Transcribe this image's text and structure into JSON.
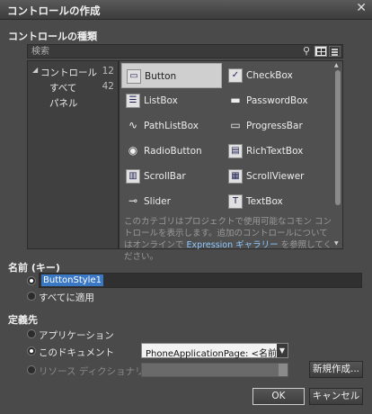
{
  "window": {
    "title": "コントロールの作成",
    "close_glyph": "✕"
  },
  "control_types": {
    "heading": "コントロールの種類",
    "search_placeholder": "検索",
    "categories": [
      {
        "label": "コントロール",
        "count": "12"
      },
      {
        "label": "すべて",
        "count": "42"
      },
      {
        "label": "パネル",
        "count": ""
      }
    ],
    "controls": [
      {
        "name": "Button",
        "icon": "button-icon",
        "selected": true
      },
      {
        "name": "CheckBox",
        "icon": "checkbox-icon"
      },
      {
        "name": "ListBox",
        "icon": "listbox-icon"
      },
      {
        "name": "PasswordBox",
        "icon": "passwordbox-icon"
      },
      {
        "name": "PathListBox",
        "icon": "pathlistbox-icon"
      },
      {
        "name": "ProgressBar",
        "icon": "progressbar-icon"
      },
      {
        "name": "RadioButton",
        "icon": "radiobutton-icon"
      },
      {
        "name": "RichTextBox",
        "icon": "richtextbox-icon"
      },
      {
        "name": "ScrollBar",
        "icon": "scrollbar-icon"
      },
      {
        "name": "ScrollViewer",
        "icon": "scrollviewer-icon"
      },
      {
        "name": "Slider",
        "icon": "slider-icon"
      },
      {
        "name": "TextBox",
        "icon": "textbox-icon"
      }
    ],
    "description_text": "このカテゴリはプロジェクトで使用可能なコモン コントロールを表示します。追加のコントロールについてはオンラインで",
    "description_link": "Expression ギャラリー",
    "description_suffix": " を参照してください。"
  },
  "name_section": {
    "heading": "名前 (キー)",
    "name_value": "ButtonStyle1",
    "apply_all_label": "すべてに適用"
  },
  "define_section": {
    "heading": "定義先",
    "application_label": "アプリケーション",
    "document_label": "このドキュメント",
    "document_select_value": "PhoneApplicationPage: <名前なし>",
    "resource_dict_label": "リソース ディクショナリ",
    "new_button_label": "新規作成..."
  },
  "footer": {
    "ok_label": "OK",
    "cancel_label": "キャンセル"
  }
}
